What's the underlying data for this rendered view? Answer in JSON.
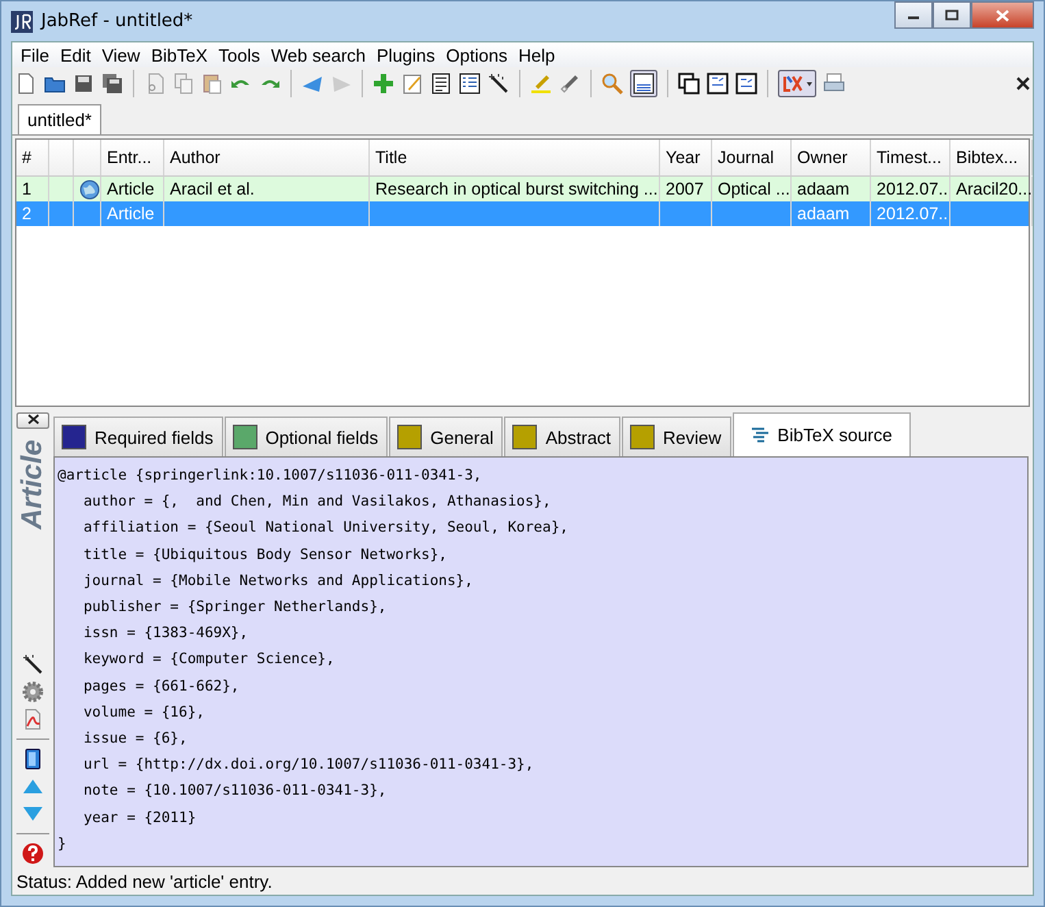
{
  "window": {
    "title": "JabRef - untitled*"
  },
  "menu": [
    "File",
    "Edit",
    "View",
    "BibTeX",
    "Tools",
    "Web search",
    "Plugins",
    "Options",
    "Help"
  ],
  "database_tabs": [
    {
      "label": "untitled*",
      "selected": true
    }
  ],
  "table": {
    "columns": [
      "#",
      "Entr...",
      "Author",
      "Title",
      "Year",
      "Journal",
      "Owner",
      "Timest...",
      "Bibtex..."
    ],
    "rows": [
      {
        "selected": false,
        "link_icon": true,
        "cells": [
          "1",
          "Article",
          "Aracil et al.",
          "Research in optical burst switching ...",
          "2007",
          "Optical ...",
          "adaam",
          "2012.07...",
          "Aracil20..."
        ]
      },
      {
        "selected": true,
        "link_icon": false,
        "cells": [
          "2",
          "Article",
          "",
          "",
          "",
          "",
          "adaam",
          "2012.07...",
          ""
        ]
      }
    ]
  },
  "entry_type": "Article",
  "editor_tabs": [
    {
      "label": "Required fields",
      "color": "#25258f",
      "kind": "fields",
      "selected": false
    },
    {
      "label": "Optional fields",
      "color": "#5aa86a",
      "kind": "fields",
      "selected": false
    },
    {
      "label": "General",
      "color": "#b5a000",
      "kind": "fields",
      "selected": false
    },
    {
      "label": "Abstract",
      "color": "#b5a000",
      "kind": "fields",
      "selected": false
    },
    {
      "label": "Review",
      "color": "#b5a000",
      "kind": "fields",
      "selected": false
    },
    {
      "label": "BibTeX source",
      "kind": "source",
      "selected": true
    }
  ],
  "source_lines": [
    "@article {springerlink:10.1007/s11036-011-0341-3,",
    "   author = {,  and Chen, Min and Vasilakos, Athanasios},",
    "   affiliation = {Seoul National University, Seoul, Korea},",
    "   title = {Ubiquitous Body Sensor Networks},",
    "   journal = {Mobile Networks and Applications},",
    "   publisher = {Springer Netherlands},",
    "   issn = {1383-469X},",
    "   keyword = {Computer Science},",
    "   pages = {661-662},",
    "   volume = {16},",
    "   issue = {6},",
    "   url = {http://dx.doi.org/10.1007/s11036-011-0341-3},",
    "   note = {10.1007/s11036-011-0341-3},",
    "   year = {2011}",
    "}"
  ],
  "status_bar": "Status: Added new 'article' entry."
}
